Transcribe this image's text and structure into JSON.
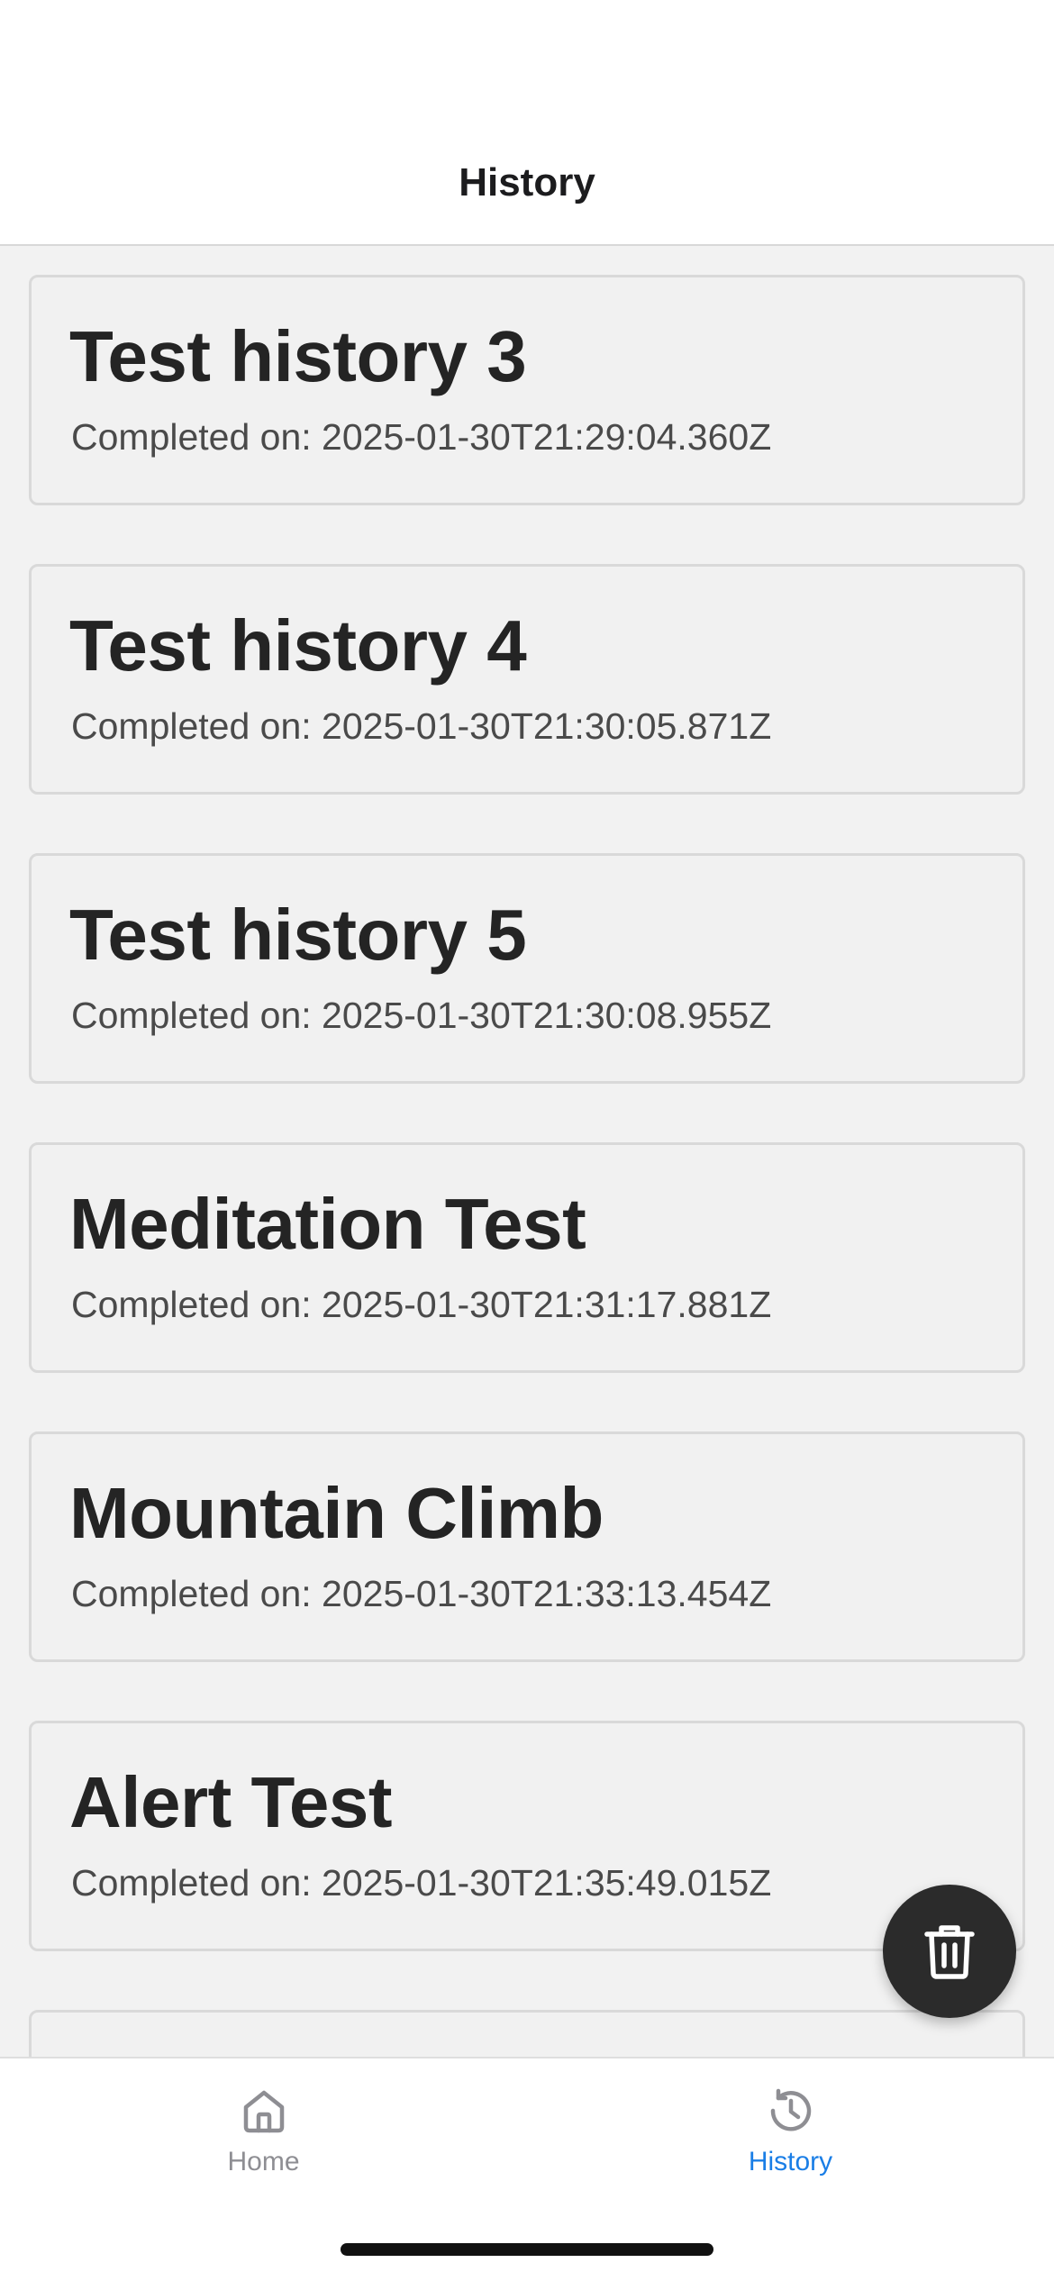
{
  "header": {
    "title": "History"
  },
  "history_items": [
    {
      "title": "Test history 3",
      "subtitle": "Completed on: 2025-01-30T21:29:04.360Z"
    },
    {
      "title": "Test history 4",
      "subtitle": "Completed on: 2025-01-30T21:30:05.871Z"
    },
    {
      "title": "Test history 5",
      "subtitle": "Completed on: 2025-01-30T21:30:08.955Z"
    },
    {
      "title": "Meditation Test",
      "subtitle": "Completed on: 2025-01-30T21:31:17.881Z"
    },
    {
      "title": "Mountain Climb",
      "subtitle": "Completed on: 2025-01-30T21:33:13.454Z"
    },
    {
      "title": "Alert Test",
      "subtitle": "Completed on: 2025-01-30T21:35:49.015Z"
    }
  ],
  "fab": {
    "icon": "trash-icon"
  },
  "tabbar": {
    "tabs": [
      {
        "label": "Home",
        "icon": "home-icon",
        "active": false
      },
      {
        "label": "History",
        "icon": "history-icon",
        "active": true
      }
    ]
  },
  "colors": {
    "accent": "#1a7ee6",
    "inactive": "#8e8e93",
    "fab_background": "#2b2b2b",
    "card_background": "#f1f1f1"
  }
}
